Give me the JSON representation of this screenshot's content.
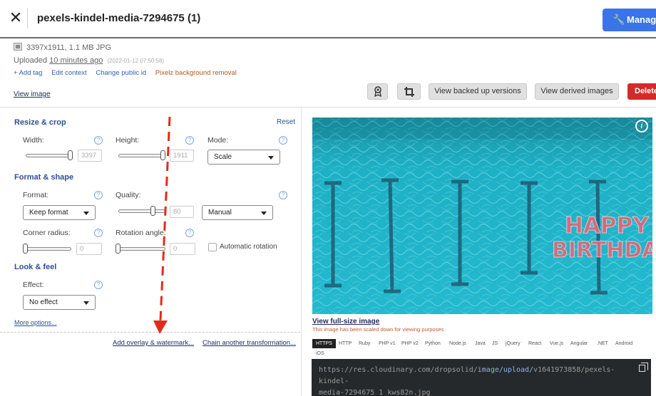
{
  "header": {
    "close_icon": "close-icon",
    "title": "pexels-kindel-media-7294675 (1)",
    "manage_label": "Manage",
    "manage_color": "#3b73e8"
  },
  "meta": {
    "file_info": "3397x1911, 1.1 MB JPG",
    "uploaded_prefix": "Uploaded",
    "uploaded_ago": "10 minutes ago",
    "uploaded_date": "(2022-01-12 07:50:58)",
    "links": [
      "+ Add tag",
      "Edit context",
      "Change public id",
      "Pixelz background removal"
    ],
    "view_image": "View image"
  },
  "toolbar": {
    "backed_up": "View backed up versions",
    "derived": "View derived images",
    "delete": "Delete",
    "delete_color": "#d42a2a"
  },
  "transform": {
    "resize_title": "Resize & crop",
    "reset": "Reset",
    "width_label": "Width:",
    "width_value": "3397",
    "height_label": "Height:",
    "height_value": "1911",
    "mode_label": "Mode:",
    "mode_value": "Scale",
    "format_title": "Format & shape",
    "format_label": "Format:",
    "format_value": "Keep format",
    "quality_label": "Quality:",
    "quality_value": "80",
    "quality_mode": "Manual",
    "corner_label": "Corner radius:",
    "corner_value": "0",
    "rotation_label": "Rotation angle:",
    "rotation_value": "0",
    "auto_rotation": "Automatic rotation",
    "look_title": "Look & feel",
    "effect_label": "Effect:",
    "effect_value": "No effect",
    "help_glyph": "?",
    "more_options": "More options...",
    "add_overlay": "Add overlay & watermark...",
    "chain": "Chain another transformation..."
  },
  "preview": {
    "image_text_line1": "HAPPY",
    "image_text_line2": "BIRTHDAY",
    "info_glyph": "i",
    "view_full": "View full-size image",
    "scaled_note": "This image has been scaled down for viewing purposes"
  },
  "code": {
    "tabs": [
      "HTTPS",
      "HTTP",
      "Ruby",
      "PHP v1",
      "PHP v2",
      "Python",
      "Node.js",
      "Java",
      "JS",
      "jQuery",
      "React",
      "Vue.js",
      "Angular",
      ".NET",
      "Android",
      "iOS"
    ],
    "url_part1": "https://res.cloudinary.com/dropsolid/",
    "url_part2": "image/upload/",
    "url_part3": "v1641973858/pexels-kindel-",
    "url_part4": "media-7294675_1_kws82n.jpg"
  }
}
